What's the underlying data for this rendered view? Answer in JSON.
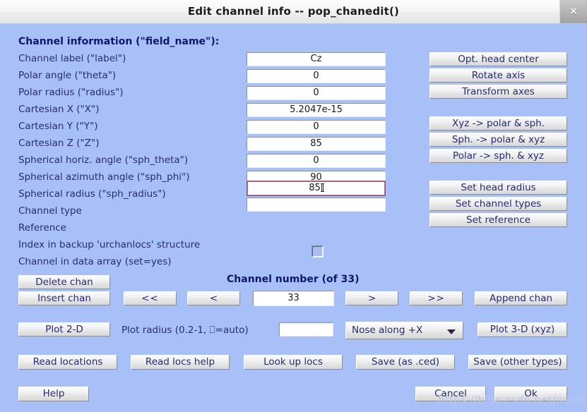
{
  "window": {
    "title": "Edit channel info -- pop_chanedit()",
    "close_label": "×"
  },
  "section": {
    "heading": "Channel information (\"field_name\"):"
  },
  "fields": [
    {
      "label": "Channel label (\"label\")",
      "value": "Cz",
      "focused": false
    },
    {
      "label": "Polar angle (\"theta\")",
      "value": "0",
      "focused": false
    },
    {
      "label": "Polar radius (\"radius\")",
      "value": "0",
      "focused": false
    },
    {
      "label": "Cartesian X (\"X\")",
      "value": "5.2047e-15",
      "focused": false
    },
    {
      "label": "Cartesian Y (\"Y\")",
      "value": "0",
      "focused": false
    },
    {
      "label": "Cartesian Z (\"Z\")",
      "value": "85",
      "focused": false
    },
    {
      "label": "Spherical horiz. angle (\"sph_theta\")",
      "value": "0",
      "focused": false
    },
    {
      "label": "Spherical azimuth angle (\"sph_phi\")",
      "value": "90",
      "focused": false
    },
    {
      "label": "Spherical radius (\"sph_radius\")",
      "value": "85",
      "focused": true
    },
    {
      "label": "Channel type",
      "value": "",
      "focused": false
    }
  ],
  "plain_labels": [
    "Reference",
    "Index in backup 'urchanlocs' structure",
    "Channel in data array (set=yes)"
  ],
  "right_buttons": {
    "group1": [
      "Opt. head center",
      "Rotate axis",
      "Transform axes"
    ],
    "group2": [
      "Xyz -> polar & sph.",
      "Sph. -> polar & xyz",
      "Polar -> sph. & xyz"
    ],
    "group3": [
      "Set head radius",
      "Set channel types",
      "Set reference"
    ]
  },
  "nav": {
    "channel_number_heading": "Channel number (of 33)",
    "delete_chan": "Delete chan",
    "insert_chan": "Insert chan",
    "first": "<<",
    "prev": "<",
    "channel_value": "33",
    "next": ">",
    "last": ">>",
    "append_chan": "Append chan"
  },
  "plot": {
    "plot_2d": "Plot 2-D",
    "radius_label": "Plot radius (0.2-1, ⎕=auto)",
    "radius_value": "",
    "nose_option": "Nose along +X",
    "plot_3d": "Plot 3-D (xyz)"
  },
  "io_buttons": [
    "Read locations",
    "Read locs help",
    "Look up locs",
    "Save (as .ced)",
    "Save (other types)"
  ],
  "bottom": {
    "help": "Help",
    "cancel": "Cancel",
    "ok": "Ok"
  },
  "watermark": {
    "text": "https://blog.csdn.net/nvsifgn"
  },
  "colors": {
    "background": "#a8c0f8",
    "label_text": "#282c6e",
    "button_text": "#242a70",
    "focus_border": "#9b4f6e"
  }
}
